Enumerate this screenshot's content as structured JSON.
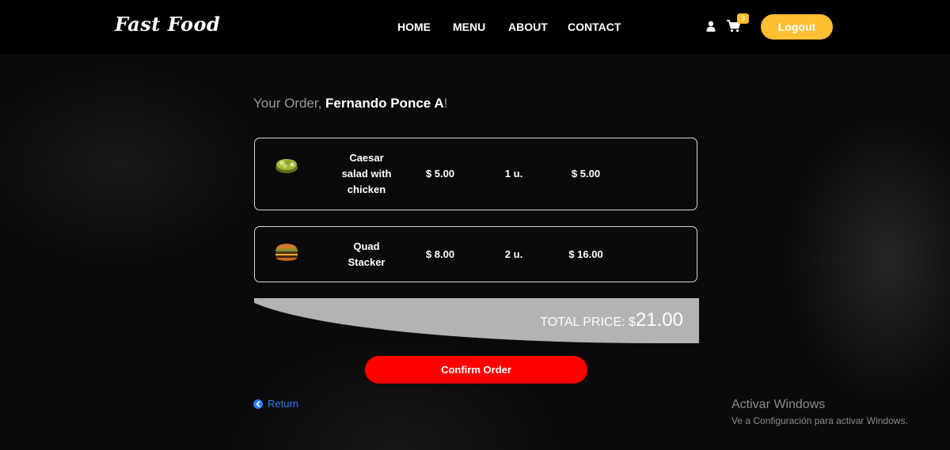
{
  "brand": "Fast Food",
  "nav": {
    "home": "HOME",
    "menu": "MENU",
    "about": "ABOUT",
    "contact": "CONTACT"
  },
  "header": {
    "cart_count": "3",
    "logout_label": "Logout",
    "icons": [
      "user-icon",
      "cart-icon"
    ]
  },
  "order": {
    "greeting_prefix": "Your Order, ",
    "customer_name": "Fernando Ponce A",
    "greeting_suffix": "!",
    "items": [
      {
        "name_lines": [
          "Caesar",
          "salad with",
          "chicken"
        ],
        "unit_price": "$ 5.00",
        "quantity": "1 u.",
        "subtotal": "$ 5.00",
        "image": "salad-image"
      },
      {
        "name_lines": [
          "Quad",
          "Stacker"
        ],
        "unit_price": "$ 8.00",
        "quantity": "2 u.",
        "subtotal": "$ 16.00",
        "image": "burger-image"
      }
    ],
    "total_label": "TOTAL PRICE: $",
    "total_value": "21.00",
    "confirm_label": "Confirm Order",
    "return_label": "Return"
  },
  "watermark": {
    "title": "Activar Windows",
    "subtitle": "Ve a Configuración para activar Windows."
  },
  "colors": {
    "accent": "#ffbe33",
    "confirm": "#ff0000",
    "link": "#2f7df6"
  }
}
